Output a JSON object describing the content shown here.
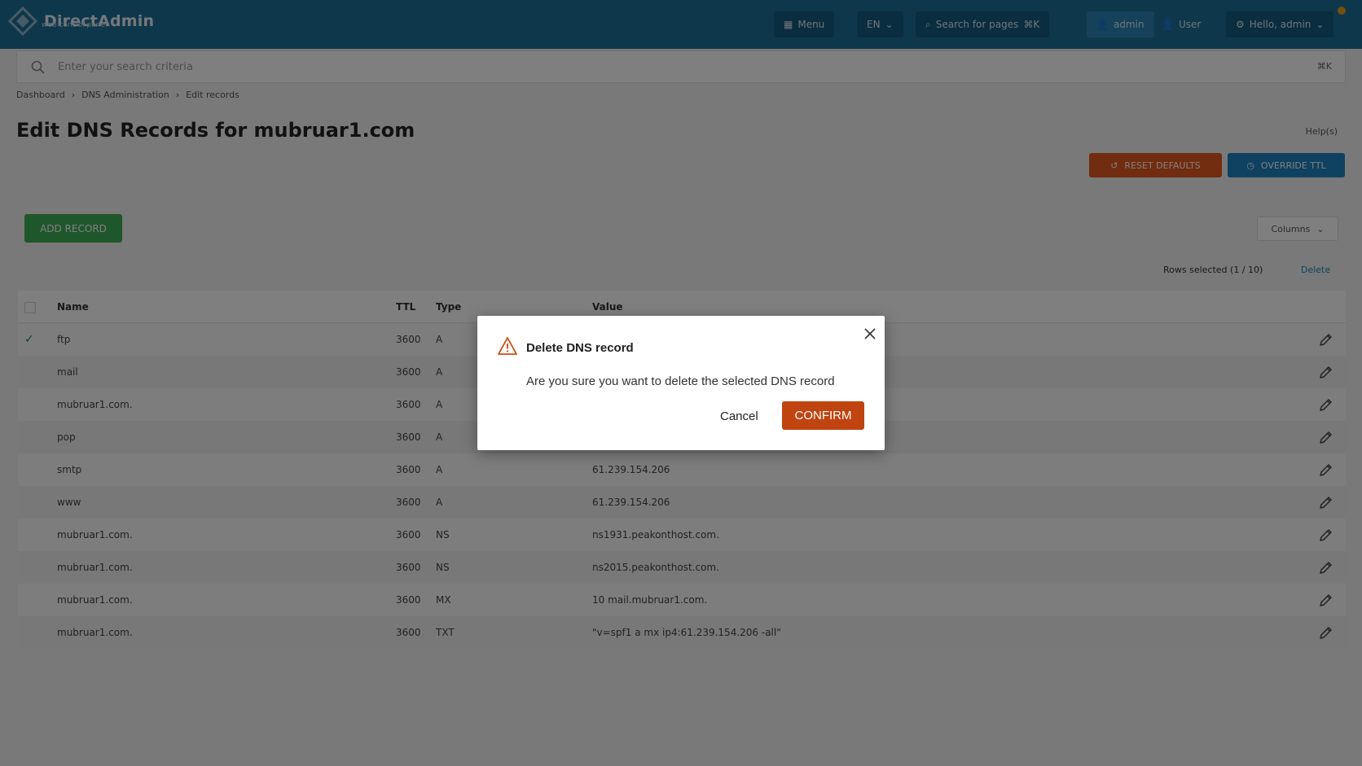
{
  "header": {
    "brand_title": "DirectAdmin",
    "brand_subtitle": "web control panel",
    "menu_label": "Menu",
    "language_label": "EN",
    "search_pages_label": "Search for pages",
    "search_pages_key": "⌘K",
    "admin_label": "admin",
    "user_label": "User",
    "hello_label": "Hello, admin"
  },
  "search": {
    "placeholder": "Enter your search criteria",
    "shortcut": "⌘K"
  },
  "breadcrumb": [
    "Dashboard",
    "DNS Administration",
    "Edit records"
  ],
  "page": {
    "title": "Edit DNS Records for mubruar1.com",
    "help_label": "Help(s)"
  },
  "toolbar": {
    "reset_label": "RESET DEFAULTS",
    "ttl_label": "OVERRIDE TTL",
    "add_label": "ADD RECORD",
    "columns_label": "Columns"
  },
  "selection": {
    "info": "Rows selected (1 / 10)",
    "delete_label": "Delete"
  },
  "table": {
    "headers": {
      "name": "Name",
      "ttl": "TTL",
      "type": "Type",
      "value": "Value"
    },
    "rows": [
      {
        "name": "ftp",
        "ttl": "3600",
        "type": "A",
        "value": "",
        "checked": true
      },
      {
        "name": "mail",
        "ttl": "3600",
        "type": "A",
        "value": "",
        "checked": false
      },
      {
        "name": "mubruar1.com.",
        "ttl": "3600",
        "type": "A",
        "value": "",
        "checked": false
      },
      {
        "name": "pop",
        "ttl": "3600",
        "type": "A",
        "value": "",
        "checked": false
      },
      {
        "name": "smtp",
        "ttl": "3600",
        "type": "A",
        "value": "61.239.154.206",
        "checked": false
      },
      {
        "name": "www",
        "ttl": "3600",
        "type": "A",
        "value": "61.239.154.206",
        "checked": false
      },
      {
        "name": "mubruar1.com.",
        "ttl": "3600",
        "type": "NS",
        "value": "ns1931.peakonthost.com.",
        "checked": false
      },
      {
        "name": "mubruar1.com.",
        "ttl": "3600",
        "type": "NS",
        "value": "ns2015.peakonthost.com.",
        "checked": false
      },
      {
        "name": "mubruar1.com.",
        "ttl": "3600",
        "type": "MX",
        "value": "10 mail.mubruar1.com.",
        "checked": false
      },
      {
        "name": "mubruar1.com.",
        "ttl": "3600",
        "type": "TXT",
        "value": "\"v=spf1 a mx ip4:61.239.154.206 -all\"",
        "checked": false
      }
    ]
  },
  "modal": {
    "title": "Delete DNS record",
    "message": "Are you sure you want to delete the selected DNS record",
    "cancel_label": "Cancel",
    "confirm_label": "CONFIRM"
  },
  "colors": {
    "header_bg": "#1f6f99",
    "confirm_bg": "#c0440f",
    "warning_icon": "#d04a10",
    "add_button": "#3fae5a",
    "reset_button": "#e4581e",
    "ttl_button": "#1f82c0"
  }
}
